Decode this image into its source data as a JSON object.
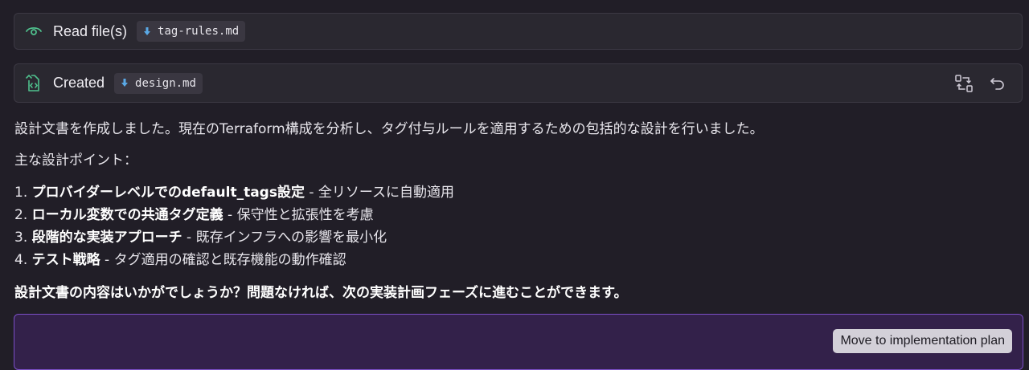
{
  "cards": [
    {
      "label": "Read file(s)",
      "icon": "eye-icon",
      "file": "tag-rules.md",
      "accent": "#4fc08d"
    },
    {
      "label": "Created",
      "icon": "code-file-icon",
      "file": "design.md",
      "accent": "#4fc08d",
      "actions": [
        "compare-icon",
        "undo-icon"
      ]
    }
  ],
  "message": {
    "intro": "設計文書を作成しました。現在のTerraform構成を分析し、タグ付与ルールを適用するための包括的な設計を行いました。",
    "points_label": "主な設計ポイント：",
    "points": [
      {
        "num": "1.",
        "title": "プロバイダーレベルでのdefault_tags設定",
        "desc": " - 全リソースに自動適用"
      },
      {
        "num": "2.",
        "title": "ローカル変数での共通タグ定義",
        "desc": " - 保守性と拡張性を考慮"
      },
      {
        "num": "3.",
        "title": "段階的な実装アプローチ",
        "desc": " - 既存インフラへの影響を最小化"
      },
      {
        "num": "4.",
        "title": "テスト戦略",
        "desc": " - タグ適用の確認と既存機能の動作確認"
      }
    ],
    "question": "設計文書の内容はいかがでしょうか？問題なければ、次の実装計画フェーズに進むことができます。"
  },
  "panel": {
    "button_label": "Move to implementation plan",
    "border_color": "#7b4fc6",
    "background": "#33214a"
  }
}
